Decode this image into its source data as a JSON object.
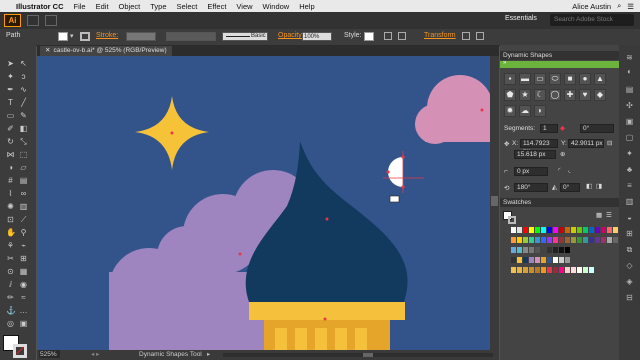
{
  "menubar": {
    "app_name": "Illustrator CC",
    "items": [
      "File",
      "Edit",
      "Object",
      "Type",
      "Select",
      "Effect",
      "View",
      "Window",
      "Help"
    ],
    "user": "Alice Austin"
  },
  "appbar": {
    "logo": "Ai",
    "workspace": "Essentials",
    "search_placeholder": "Search Adobe Stock"
  },
  "control_bar": {
    "selection_label": "Path",
    "stroke_label": "Stroke:",
    "brush_label": "Basic",
    "opacity_label": "Opacity:",
    "opacity_value": "100%",
    "style_label": "Style:",
    "transform_label": "Transform"
  },
  "document": {
    "tab_title": "castle-ov-b.ai* @ 525% (RGB/Preview)",
    "zoom": "525%",
    "status_tool": "Dynamic Shapes Tool"
  },
  "panels": {
    "dynamic_shapes": {
      "title": "Dynamic Shapes",
      "segments_label": "Segments:",
      "segments_value": "1",
      "angle_value": "0°",
      "x_label": "X:",
      "x_value": "114.7923 px",
      "y_label": "Y:",
      "y_value": "42.9011 px",
      "width_value": "15.618 px",
      "corner_value": "0 px",
      "rotation_value": "180°",
      "radius_value": "0°"
    },
    "swatches": {
      "title": "Swatches"
    }
  },
  "colors": {
    "canvas": "#33548b",
    "star": "#f6c338",
    "dome": "#12395e",
    "cloud_purple": "#9e85c0",
    "cloud_pink": "#d491b5",
    "tower_gold": "#f5c13d",
    "tower_orange": "#e5a42a",
    "accent_orange": "#f7941d"
  },
  "icons": [
    "apple-icon",
    "selection-tool-icon",
    "direct-selection-icon",
    "pen-tool-icon",
    "type-tool-icon",
    "rectangle-tool-icon",
    "zoom-tool-icon",
    "hand-tool-icon"
  ]
}
